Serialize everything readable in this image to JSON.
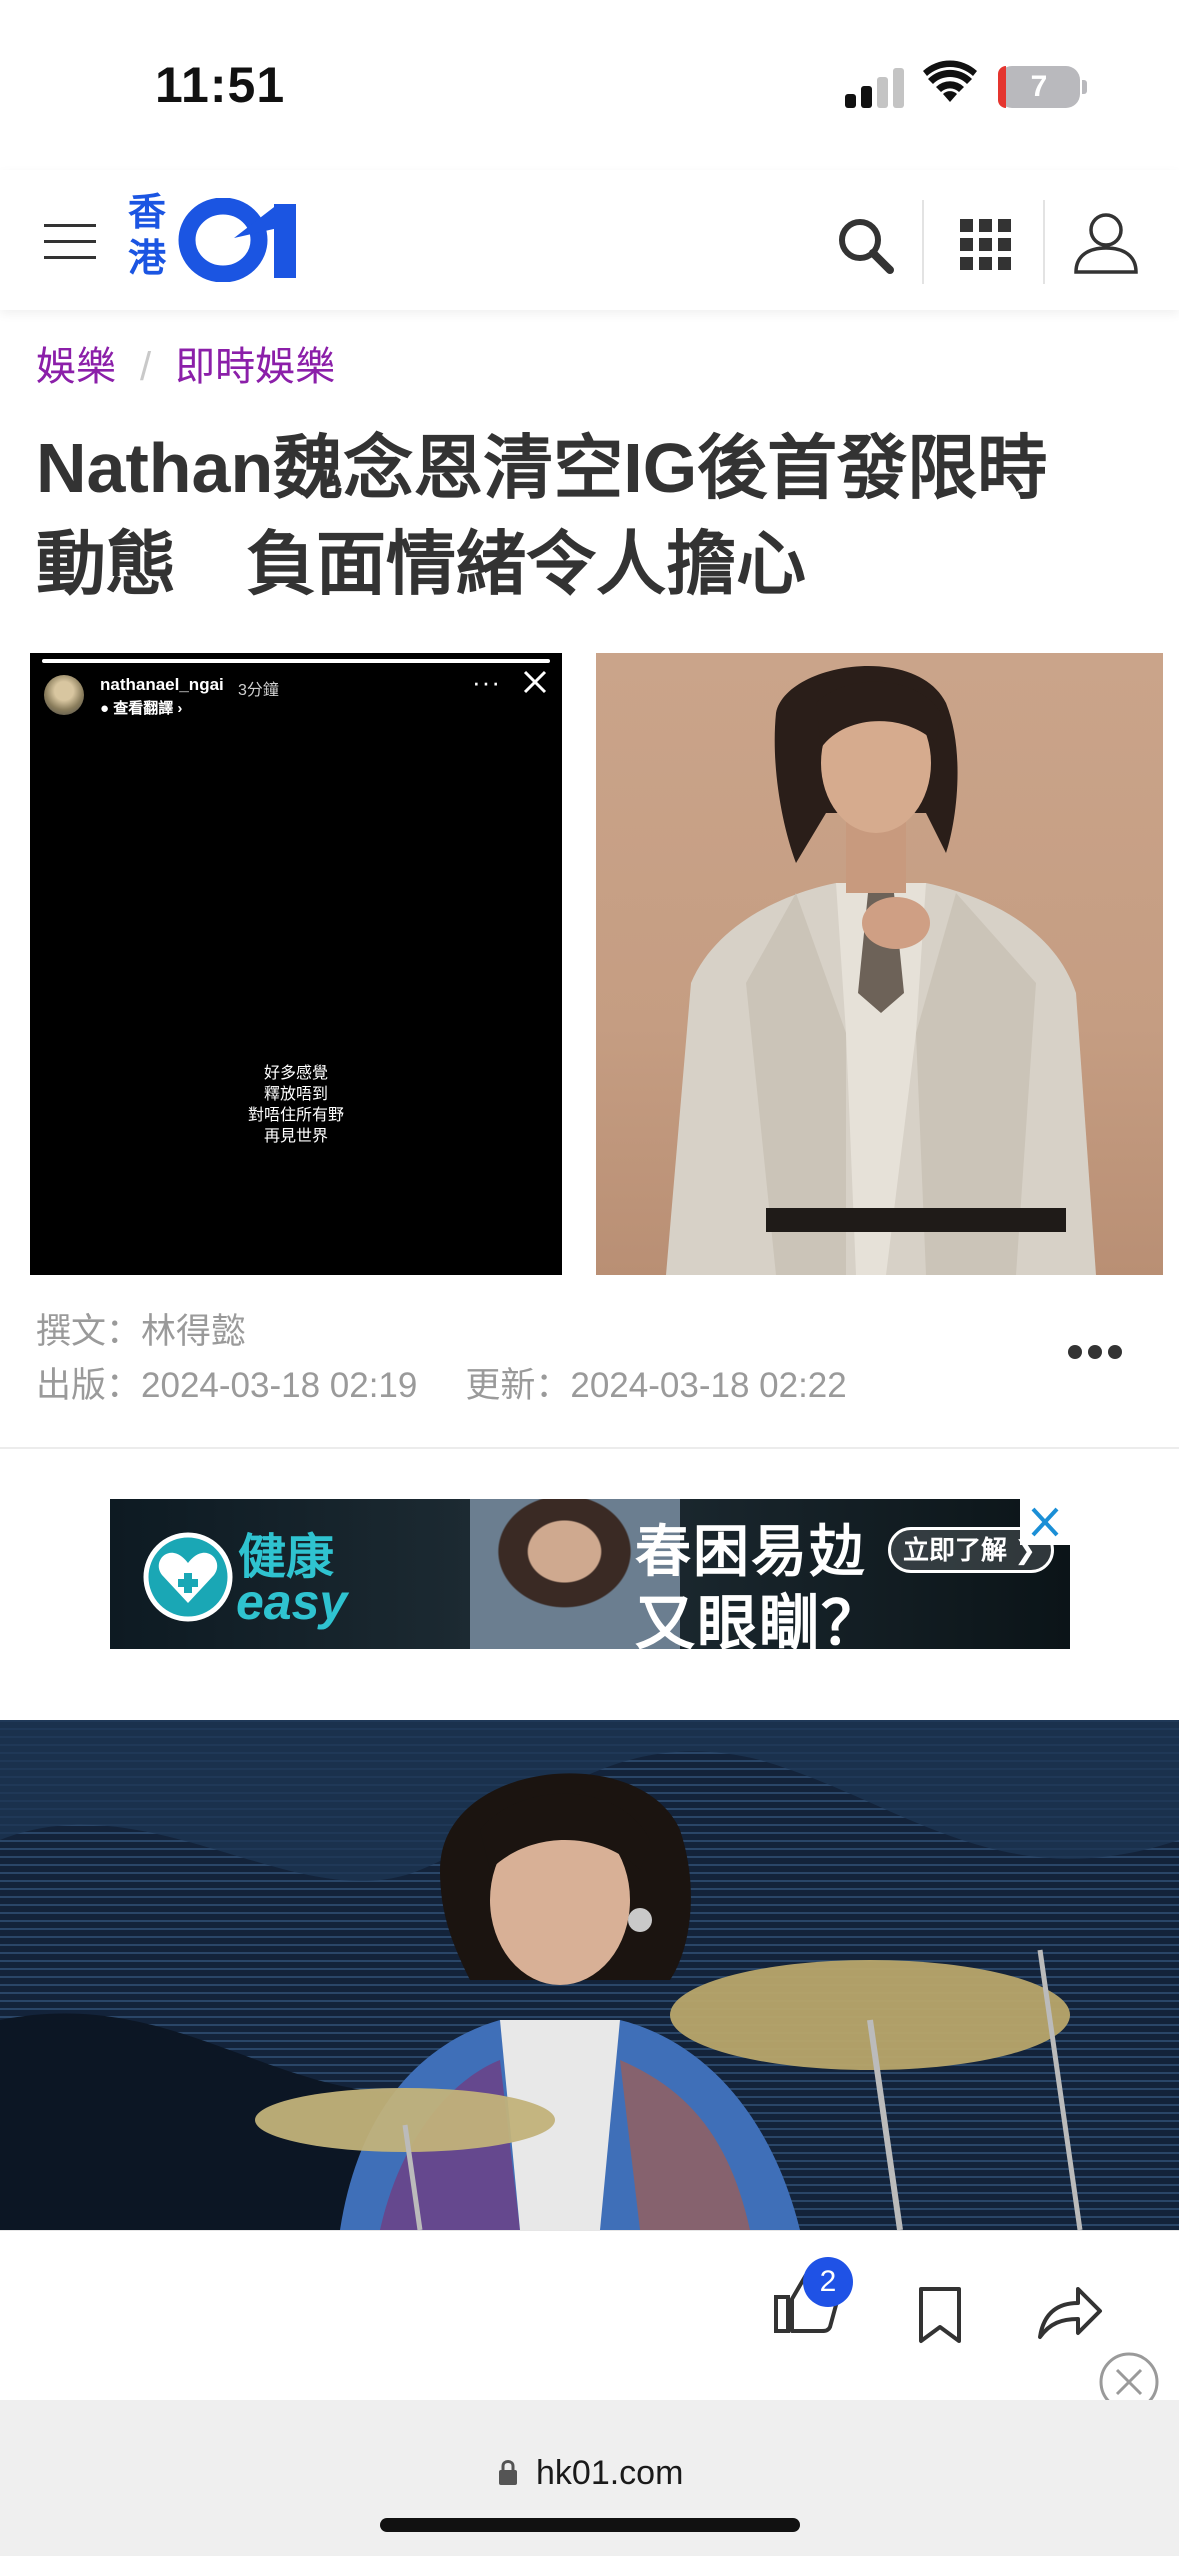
{
  "status_bar": {
    "time": "11:51",
    "battery": "7"
  },
  "header": {
    "logo_chinese": "香港",
    "logo_text": "01"
  },
  "breadcrumb": {
    "category": "娛樂",
    "subcategory": "即時娛樂"
  },
  "article": {
    "title_line1": "Nathan魏念恩清空IG後首發限時",
    "title_line2": "動態　負面情緒令人擔心",
    "author_label": "撰文：",
    "author": "林得懿",
    "published_label": "出版：",
    "published": "2024-03-18 02:19",
    "updated_label": "更新：",
    "updated": "2024-03-18 02:22"
  },
  "story_screenshot": {
    "username": "nathanael_ngai",
    "time_ago": "3分鐘",
    "translate": "查看翻譯 ›",
    "lines": [
      "好多感覺",
      "釋放唔到",
      "對唔住所有野",
      "再見世界"
    ]
  },
  "ad": {
    "brand_line1": "健康",
    "brand_line2": "easy",
    "headline1": "春困易攰",
    "headline2": "又眼瞓？",
    "cta": "立即了解"
  },
  "actions": {
    "like_count": "2"
  },
  "browser": {
    "url": "hk01.com"
  },
  "colors": {
    "brand_blue": "#1b55e2",
    "breadcrumb_purple": "#8b1fa9",
    "badge_blue": "#1f52e6"
  }
}
